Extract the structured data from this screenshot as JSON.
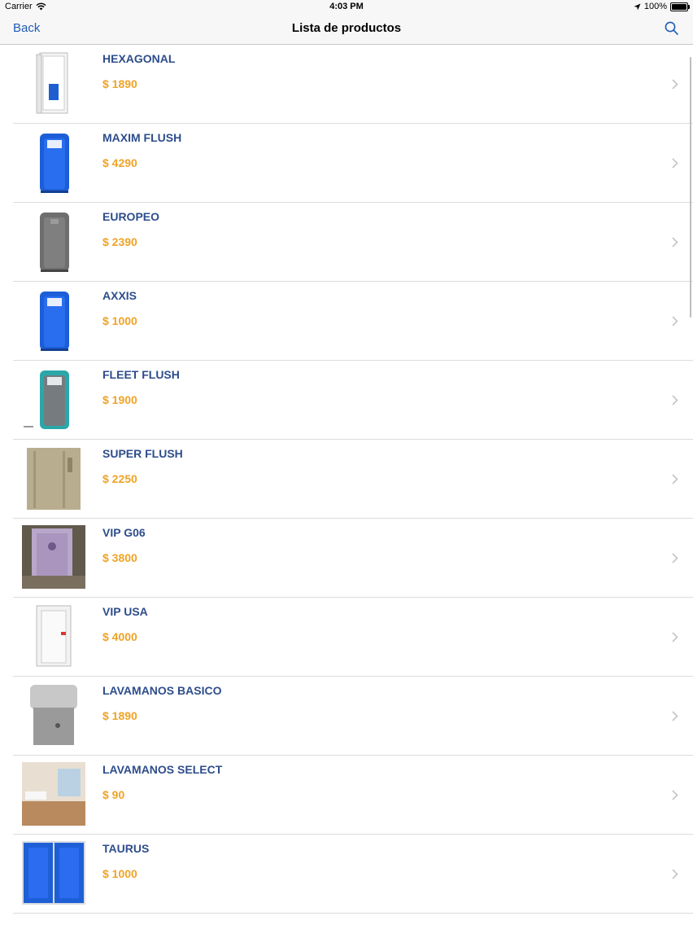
{
  "status": {
    "carrier": "Carrier",
    "time": "4:03 PM",
    "battery": "100%",
    "battery_level": 1.0
  },
  "nav": {
    "back_label": "Back",
    "title": "Lista de productos",
    "search_icon": "search-icon"
  },
  "colors": {
    "name": "#2e4d8c",
    "price": "#f0a325",
    "accent": "#1f5bb5"
  },
  "products": [
    {
      "name": "HEXAGONAL",
      "price": "$ 1890",
      "image": "white-hexagonal-unit"
    },
    {
      "name": "MAXIM FLUSH",
      "price": "$ 4290",
      "image": "blue-portable-toilet"
    },
    {
      "name": "EUROPEO",
      "price": "$ 2390",
      "image": "gray-portable-toilet"
    },
    {
      "name": "AXXIS",
      "price": "$ 1000",
      "image": "blue-portable-toilet"
    },
    {
      "name": "FLEET FLUSH",
      "price": "$ 1900",
      "image": "teal-portable-toilet"
    },
    {
      "name": "SUPER FLUSH",
      "price": "$ 2250",
      "image": "beige-portable-toilet"
    },
    {
      "name": "VIP G06",
      "price": "$ 3800",
      "image": "purple-vip-cabin"
    },
    {
      "name": "VIP USA",
      "price": "$ 4000",
      "image": "white-vip-cabin"
    },
    {
      "name": "LAVAMANOS BASICO",
      "price": "$ 1890",
      "image": "gray-handwash-station"
    },
    {
      "name": "LAVAMANOS SELECT",
      "price": "$ 90",
      "image": "bathroom-interior"
    },
    {
      "name": "TAURUS",
      "price": "$ 1000",
      "image": "blue-double-cabins"
    }
  ]
}
